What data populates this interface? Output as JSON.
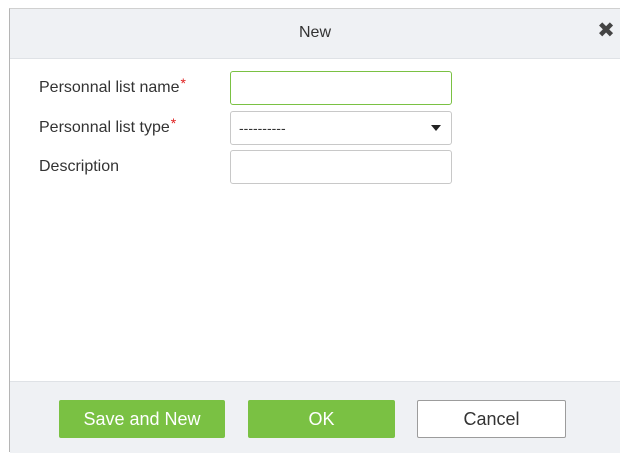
{
  "dialog": {
    "title": "New",
    "close_glyph": "✕"
  },
  "form": {
    "name_label": "Personnal list name",
    "name_required": "*",
    "name_value": "",
    "type_label": "Personnal list type",
    "type_required": "*",
    "type_selected": "----------",
    "description_label": "Description",
    "description_value": ""
  },
  "footer": {
    "save_new_label": "Save and New",
    "ok_label": "OK",
    "cancel_label": "Cancel"
  },
  "colors": {
    "accent_green": "#7ac143",
    "required_red": "#e02020",
    "header_bg": "#eff1f4"
  }
}
